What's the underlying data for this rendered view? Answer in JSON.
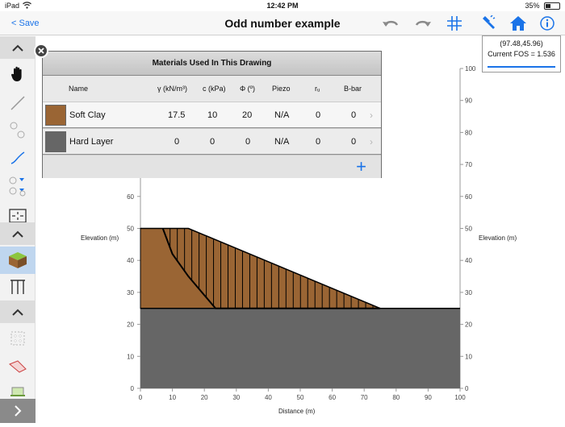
{
  "status": {
    "device": "iPad",
    "time": "12:42 PM",
    "battery": "35%",
    "battery_level": 0.35
  },
  "nav": {
    "back_label": "< Save",
    "title": "Odd number example"
  },
  "fos": {
    "coords": "(97.48,45.96)",
    "label": "Current FOS = 1.536"
  },
  "materials": {
    "title": "Materials Used In This Drawing",
    "headers": {
      "name": "Name",
      "gamma": "γ (kN/m³)",
      "c": "c (kPa)",
      "phi": "Φ (º)",
      "piezo": "Piezo",
      "ru": "rᵤ",
      "bbar": "B-bar"
    },
    "rows": [
      {
        "name": "Soft Clay",
        "gamma": "17.5",
        "c": "10",
        "phi": "20",
        "piezo": "N/A",
        "ru": "0",
        "bbar": "0",
        "color": "#9a6534"
      },
      {
        "name": "Hard Layer",
        "gamma": "0",
        "c": "0",
        "phi": "0",
        "piezo": "N/A",
        "ru": "0",
        "bbar": "0",
        "color": "#666666"
      }
    ],
    "chevron": "›",
    "add_symbol": "+"
  },
  "chart_data": {
    "type": "diagram",
    "xlabel": "Distance (m)",
    "ylabel_left": "Elevation (m)",
    "ylabel_right": "Elevation (m)",
    "xlim": [
      0,
      100
    ],
    "ylim": [
      0,
      100
    ],
    "x_ticks": [
      "0",
      "10",
      "20",
      "30",
      "40",
      "50",
      "60",
      "70",
      "80",
      "90",
      "100"
    ],
    "y_ticks": [
      "0",
      "10",
      "20",
      "30",
      "40",
      "50",
      "60",
      "70",
      "80",
      "90",
      "100"
    ],
    "soft_clay_boundary": [
      [
        0,
        50
      ],
      [
        15,
        50
      ],
      [
        75,
        25
      ],
      [
        0,
        25
      ]
    ],
    "hard_layer": [
      [
        0,
        25
      ],
      [
        100,
        25
      ],
      [
        100,
        0
      ],
      [
        0,
        0
      ]
    ],
    "slip_surface": [
      [
        7,
        50
      ],
      [
        10,
        42
      ],
      [
        15,
        35
      ],
      [
        23.5,
        25
      ],
      [
        75,
        25
      ]
    ],
    "colors": {
      "soft_clay": "#9a6534",
      "hard_layer": "#666666",
      "outline": "#000000"
    }
  },
  "icons": {
    "sidebar": [
      "chevron-up-icon",
      "hand-icon",
      "line-icon",
      "point-icon",
      "polyline-icon",
      "piezo-icon",
      "fit-view-icon",
      "chevron-up-icon",
      "material-cube-icon",
      "ruler-icon",
      "chevron-up-icon",
      "grid-icon",
      "slip-region-icon",
      "surface-icon",
      "expand-arrow-icon"
    ]
  }
}
